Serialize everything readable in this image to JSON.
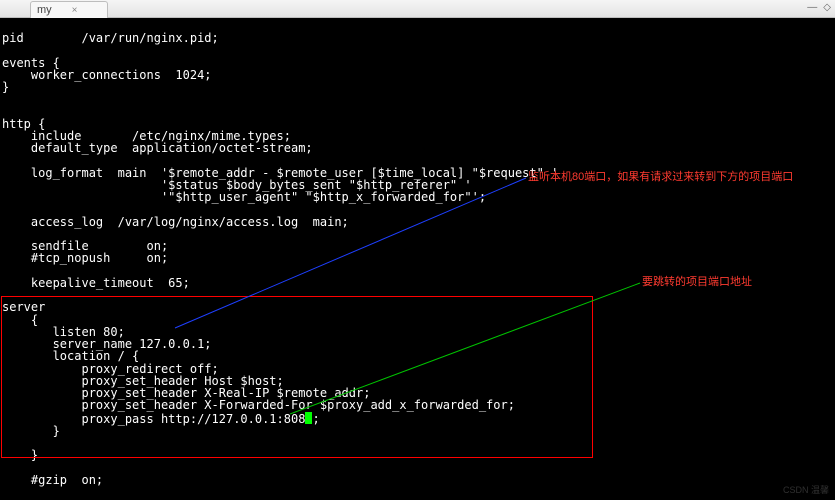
{
  "titlebar": {
    "tab_label": "my",
    "close_glyph": "×",
    "min_glyph": "—",
    "max_glyph": "◇"
  },
  "code": {
    "l01": "pid        /var/run/nginx.pid;",
    "l02": "",
    "l03": "events {",
    "l04": "    worker_connections  1024;",
    "l05": "}",
    "l06": "",
    "l07": "",
    "l08": "http {",
    "l09": "    include       /etc/nginx/mime.types;",
    "l10": "    default_type  application/octet-stream;",
    "l11": "",
    "l12": "    log_format  main  '$remote_addr - $remote_user [$time_local] \"$request\" '",
    "l13": "                      '$status $body_bytes_sent \"$http_referer\" '",
    "l14": "                      '\"$http_user_agent\" \"$http_x_forwarded_for\"';",
    "l15": "",
    "l16": "    access_log  /var/log/nginx/access.log  main;",
    "l17": "",
    "l18": "    sendfile        on;",
    "l19": "    #tcp_nopush     on;",
    "l20": "",
    "l21": "    keepalive_timeout  65;",
    "l22": "",
    "l23": "server",
    "l24": "    {",
    "l25": "       listen 80;",
    "l26": "       server_name 127.0.0.1;",
    "l27": "       location / {",
    "l28": "           proxy_redirect off;",
    "l29": "           proxy_set_header Host $host;",
    "l30": "           proxy_set_header X-Real-IP $remote_addr;",
    "l31": "           proxy_set_header X-Forwarded-For $proxy_add_x_forwarded_for;",
    "l32a": "           proxy_pass http://127.0.0.1:808",
    "l32b": ";",
    "l33": "       }",
    "l34": "",
    "l35": "    }",
    "l36": "",
    "l37": "    #gzip  on;"
  },
  "annotations": {
    "note1": "监听本机80端口，如果有请求过来转到下方的项目端口",
    "note2": "要跳转的项目端口地址"
  },
  "watermark": "CSDN 温馨"
}
